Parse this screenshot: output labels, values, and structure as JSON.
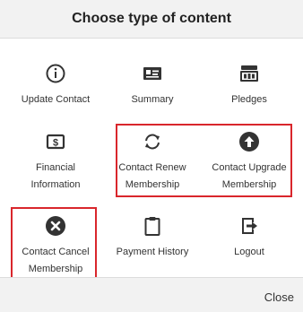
{
  "dialog": {
    "title": "Choose type of content",
    "close_label": "Close",
    "highlight_color": "#d9262c"
  },
  "items": [
    {
      "label": "Update Contact",
      "icon": "info-circle-icon"
    },
    {
      "label": "Summary",
      "icon": "id-card-icon"
    },
    {
      "label": "Pledges",
      "icon": "money-stack-icon"
    },
    {
      "label": "Financial Information",
      "icon": "dollar-square-icon"
    },
    {
      "label": "Contact Renew Membership",
      "icon": "refresh-arrows-icon"
    },
    {
      "label": "Contact Upgrade Membership",
      "icon": "arrow-up-circle-icon"
    },
    {
      "label": "Contact Cancel Membership",
      "icon": "x-circle-icon"
    },
    {
      "label": "Payment History",
      "icon": "clipboard-icon"
    },
    {
      "label": "Logout",
      "icon": "logout-icon"
    }
  ]
}
